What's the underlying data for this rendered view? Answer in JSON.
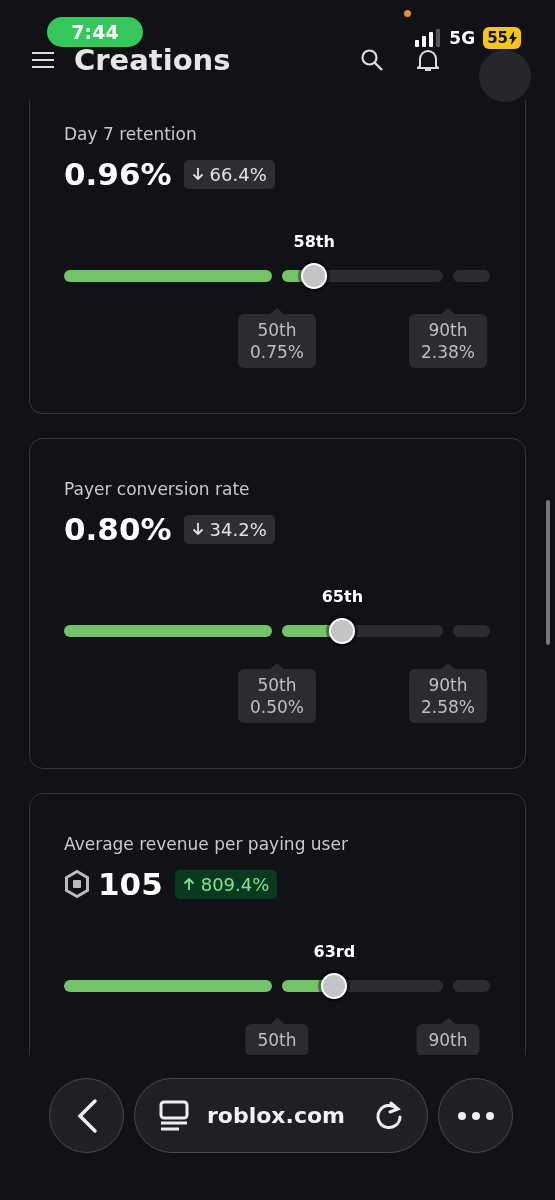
{
  "status_bar": {
    "time": "7:44",
    "network": "5G",
    "battery": "55",
    "charging": true
  },
  "header": {
    "title": "Creations"
  },
  "cards": [
    {
      "title": "Day 7 retention",
      "value": "0.96%",
      "coin_icon": false,
      "delta": {
        "kind": "decrease",
        "text": "66.4%"
      },
      "percentile": "58th",
      "level": 0.2,
      "ticks": [
        {
          "label": "50th",
          "value": "0.75%"
        },
        {
          "label": "90th",
          "value": "2.38%"
        }
      ]
    },
    {
      "title": "Payer conversion rate",
      "value": "0.80%",
      "coin_icon": false,
      "delta": {
        "kind": "decrease",
        "text": "34.2%"
      },
      "percentile": "65th",
      "level": 0.375,
      "ticks": [
        {
          "label": "50th",
          "value": "0.50%"
        },
        {
          "label": "90th",
          "value": "2.58%"
        }
      ]
    },
    {
      "title": "Average revenue per paying user",
      "value": "105",
      "coin_icon": true,
      "delta": {
        "kind": "increase",
        "text": "809.4%"
      },
      "percentile": "63rd",
      "level": 0.325,
      "ticks": [
        {
          "label": "50th"
        },
        {
          "label": "90th"
        }
      ]
    }
  ],
  "browser_bar": {
    "address": "roblox.com"
  }
}
